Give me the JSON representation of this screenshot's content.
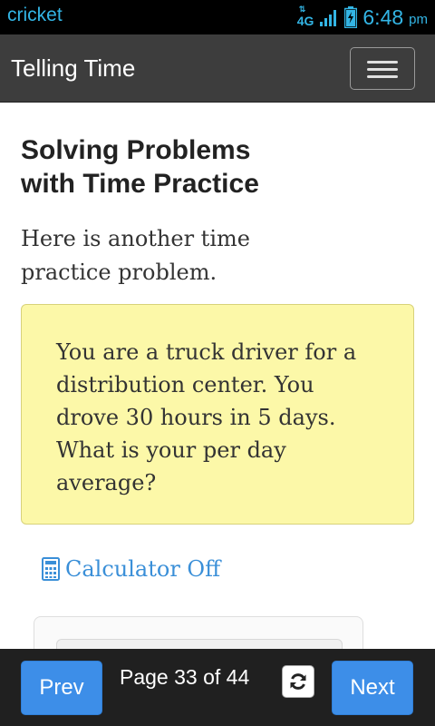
{
  "status_bar": {
    "carrier": "cricket",
    "network": "4G",
    "time": "6:48",
    "ampm": "pm",
    "icons": [
      "data-arrows-icon",
      "signal-icon",
      "battery-charging-icon"
    ]
  },
  "navbar": {
    "title": "Telling Time",
    "menu_icon": "hamburger-icon"
  },
  "main": {
    "title": "Solving Problems with Time Practice",
    "intro": "Here is another time practice problem.",
    "problem": "You are a truck driver for a distribution center. You drove 30 hours in 5 days. What is your per day average?",
    "calculator_label": "Calculator Off",
    "calculator_icon": "calculator-icon"
  },
  "footer": {
    "prev_label": "Prev",
    "next_label": "Next",
    "page_indicator": "Page 33 of 44",
    "refresh_icon": "refresh-icon"
  },
  "colors": {
    "accent": "#33b5e5",
    "navbar_bg": "#3d3d3d",
    "problem_bg": "#fcf8a8",
    "link": "#3a8fd8",
    "button": "#3d8ee8",
    "footer_bg": "#202020"
  }
}
